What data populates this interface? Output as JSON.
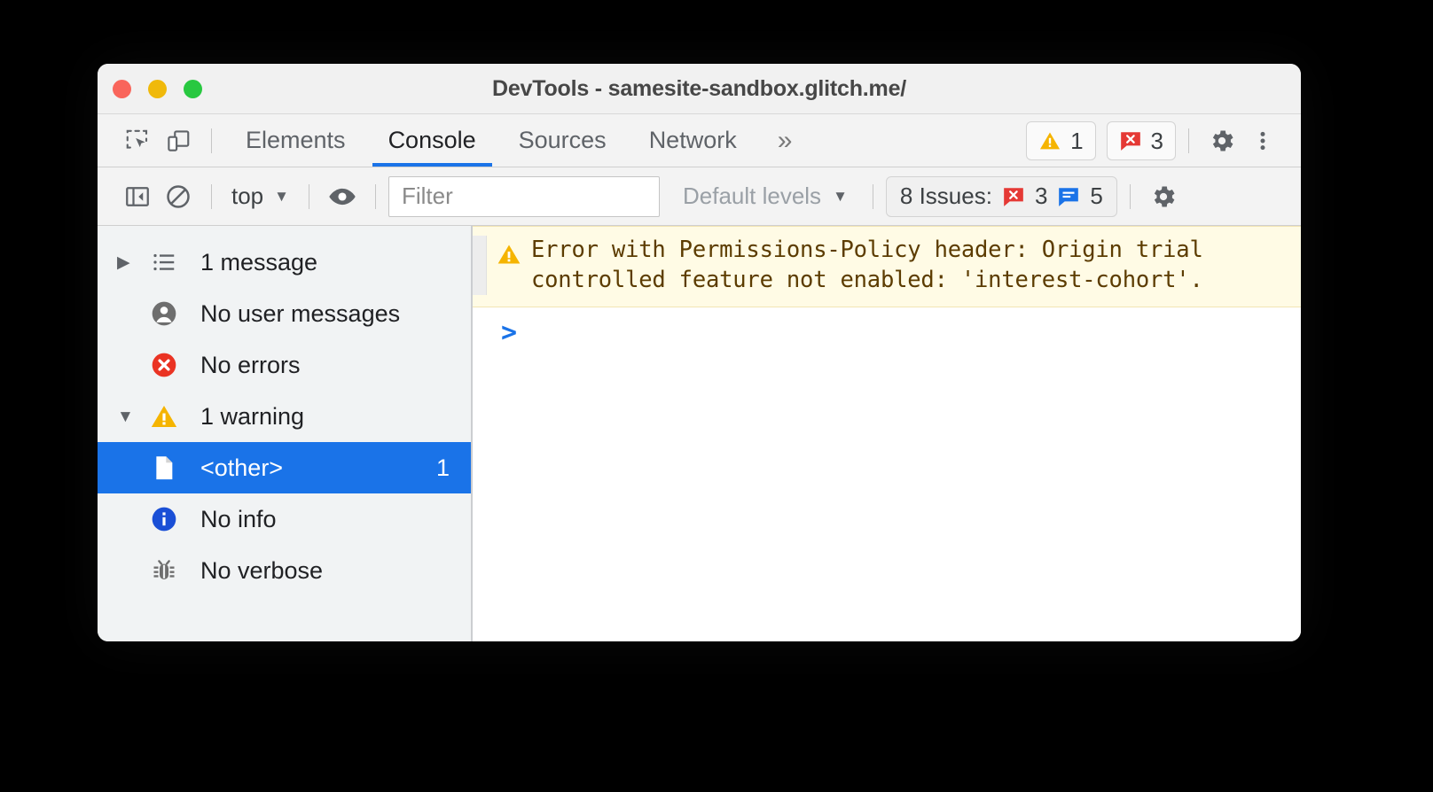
{
  "window": {
    "title": "DevTools - samesite-sandbox.glitch.me/",
    "traffic_lights": [
      "close",
      "minimize",
      "maximize"
    ],
    "colors": {
      "close": "#F9655B",
      "minimize": "#F0B90B",
      "maximize": "#28C840"
    }
  },
  "tabbar": {
    "inspect_icon": "inspect-element-icon",
    "device_icon": "device-toolbar-icon",
    "tabs": [
      {
        "label": "Elements",
        "active": false
      },
      {
        "label": "Console",
        "active": true
      },
      {
        "label": "Sources",
        "active": false
      },
      {
        "label": "Network",
        "active": false
      }
    ],
    "more_tabs": "»",
    "warning_badge": {
      "icon": "warning-triangle-icon",
      "count": "1"
    },
    "error_badge": {
      "icon": "error-speech-bubble-icon",
      "count": "3"
    },
    "settings_icon": "gear-icon",
    "more_options_icon": "kebab-menu-icon",
    "accent": "#1A73E8"
  },
  "console_toolbar": {
    "sidebar_toggle_icon": "show-console-sidebar-icon",
    "clear_console_icon": "clear-console-icon",
    "context_selector": {
      "value": "top",
      "caret": "▼"
    },
    "live_expression_icon": "eye-icon",
    "filter": {
      "value": "",
      "placeholder": "Filter"
    },
    "log_levels": {
      "value": "Default levels",
      "caret": "▼"
    },
    "issues": {
      "label": "8 Issues:",
      "error_icon": "issue-error-icon",
      "error_count": "3",
      "info_icon": "issue-info-icon",
      "info_count": "5"
    },
    "settings_icon": "gear-icon"
  },
  "sidebar": {
    "items": [
      {
        "disclosure": "▶",
        "icon": "message-list-icon",
        "label": "1 message",
        "count": "",
        "selected": false,
        "child": false
      },
      {
        "disclosure": "",
        "icon": "user-message-icon",
        "label": "No user messages",
        "count": "",
        "selected": false,
        "child": false
      },
      {
        "disclosure": "",
        "icon": "error-circle-icon",
        "label": "No errors",
        "count": "",
        "selected": false,
        "child": false
      },
      {
        "disclosure": "▼",
        "icon": "warning-triangle-icon",
        "label": "1 warning",
        "count": "",
        "selected": false,
        "child": false
      },
      {
        "disclosure": "",
        "icon": "file-icon",
        "label": "<other>",
        "count": "1",
        "selected": true,
        "child": true
      },
      {
        "disclosure": "",
        "icon": "info-circle-icon",
        "label": "No info",
        "count": "",
        "selected": false,
        "child": false
      },
      {
        "disclosure": "",
        "icon": "bug-icon",
        "label": "No verbose",
        "count": "",
        "selected": false,
        "child": false
      }
    ]
  },
  "console": {
    "messages": [
      {
        "level": "warning",
        "icon": "warning-triangle-icon",
        "text": "Error with Permissions-Policy header: Origin trial\ncontrolled feature not enabled: 'interest-cohort'."
      }
    ],
    "prompt": ">"
  }
}
